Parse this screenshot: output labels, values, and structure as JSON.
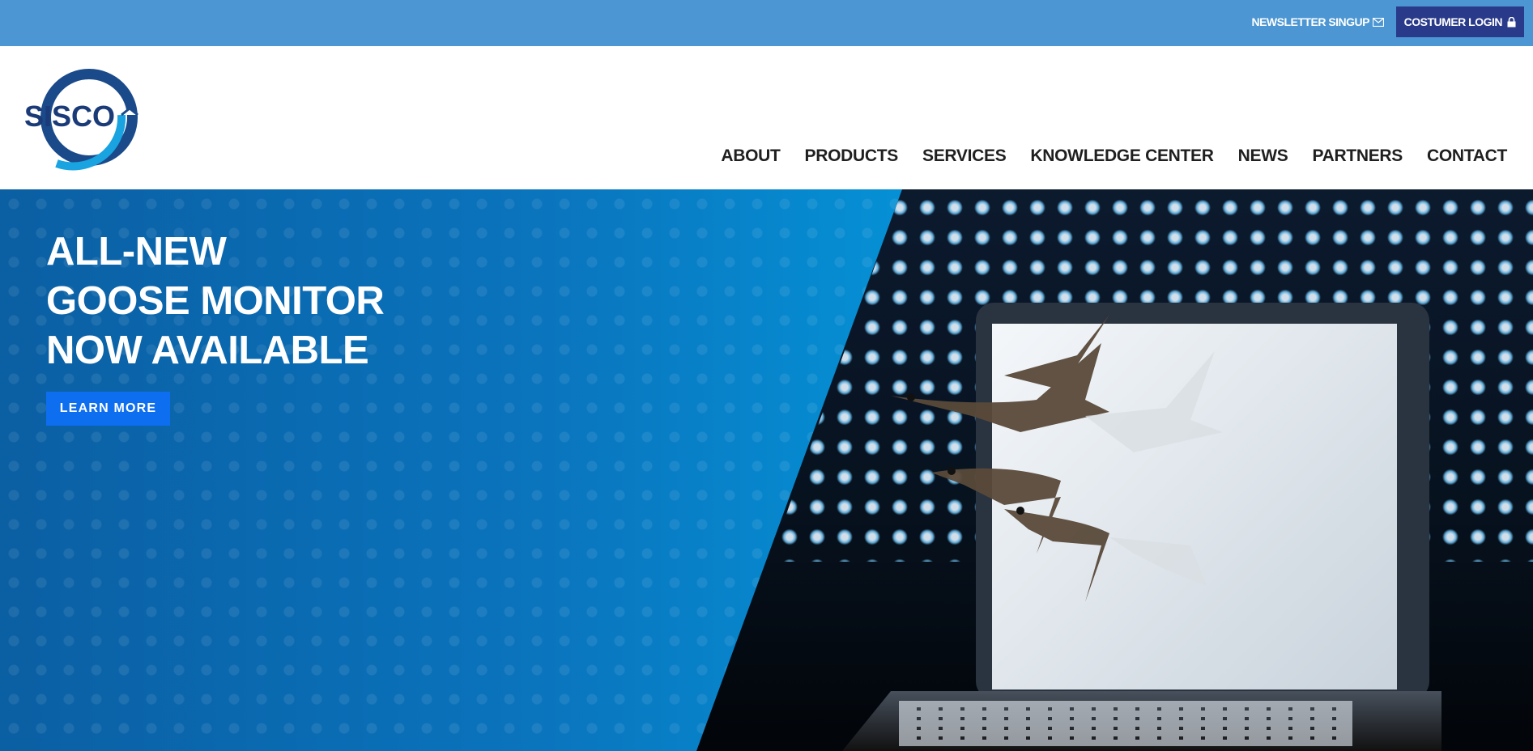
{
  "topbar": {
    "newsletter_label": "NEWSLETTER SINGUP",
    "newsletter_icon": "envelope-icon",
    "login_label": "COSTUMER LOGIN",
    "login_icon": "lock-icon"
  },
  "header": {
    "logo_text": "SISCO",
    "nav": [
      "ABOUT",
      "PRODUCTS",
      "SERVICES",
      "KNOWLEDGE CENTER",
      "NEWS",
      "PARTNERS",
      "CONTACT"
    ]
  },
  "hero": {
    "headline_lines": [
      "ALL-NEW",
      "GOOSE MONITOR",
      "NOW AVAILABLE"
    ],
    "cta_label": "LEARN MORE",
    "image": "geese-flying-out-of-laptop"
  },
  "colors": {
    "topbar": "#4c97d3",
    "login_button": "#2a3a8a",
    "cta": "#0d6ef0",
    "logo": "#1a3a78"
  }
}
